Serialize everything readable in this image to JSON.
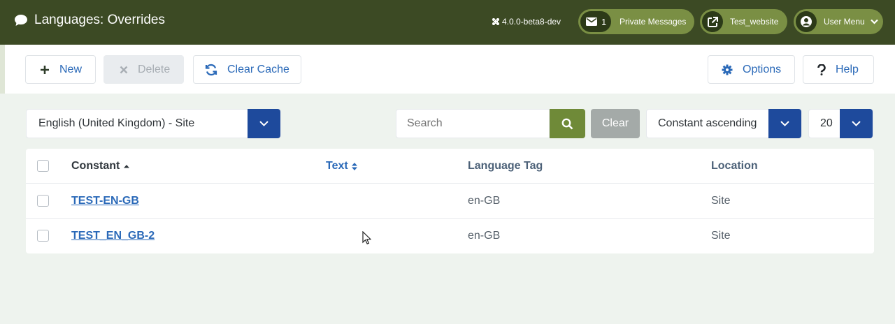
{
  "header": {
    "title": "Languages: Overrides",
    "version": "4.0.0-beta8-dev",
    "messages_count": "1",
    "messages_label": "Private Messages",
    "site_label": "Test_website",
    "user_label": "User Menu"
  },
  "toolbar": {
    "new_label": "New",
    "delete_label": "Delete",
    "clear_cache_label": "Clear Cache",
    "options_label": "Options",
    "help_label": "Help"
  },
  "filters": {
    "language_value": "English (United Kingdom) - Site",
    "search_placeholder": "Search",
    "clear_label": "Clear",
    "ordering_value": "Constant ascending",
    "limit_value": "20"
  },
  "table": {
    "headers": {
      "constant": "Constant",
      "text": "Text",
      "language_tag": "Language Tag",
      "location": "Location"
    },
    "rows": [
      {
        "constant": "TEST-EN-GB",
        "text": "",
        "language_tag": "en-GB",
        "location": "Site"
      },
      {
        "constant": "TEST_EN_GB-2",
        "text": "",
        "language_tag": "en-GB",
        "location": "Site"
      }
    ]
  },
  "icons": {
    "title": "comment-icon",
    "version": "joomla-icon",
    "messages": "envelope-icon",
    "site": "external-link-icon",
    "user": "user-circle-icon",
    "new": "plus-icon",
    "delete": "times-icon",
    "clear_cache": "sync-icon",
    "options": "gear-icon",
    "help": "question-icon",
    "search": "search-icon"
  },
  "colors": {
    "header": "#3c4a24",
    "pill": "#7a8f44",
    "accent_blue": "#1e4a9c",
    "link": "#2a69b8",
    "search_green": "#6f8a38"
  }
}
